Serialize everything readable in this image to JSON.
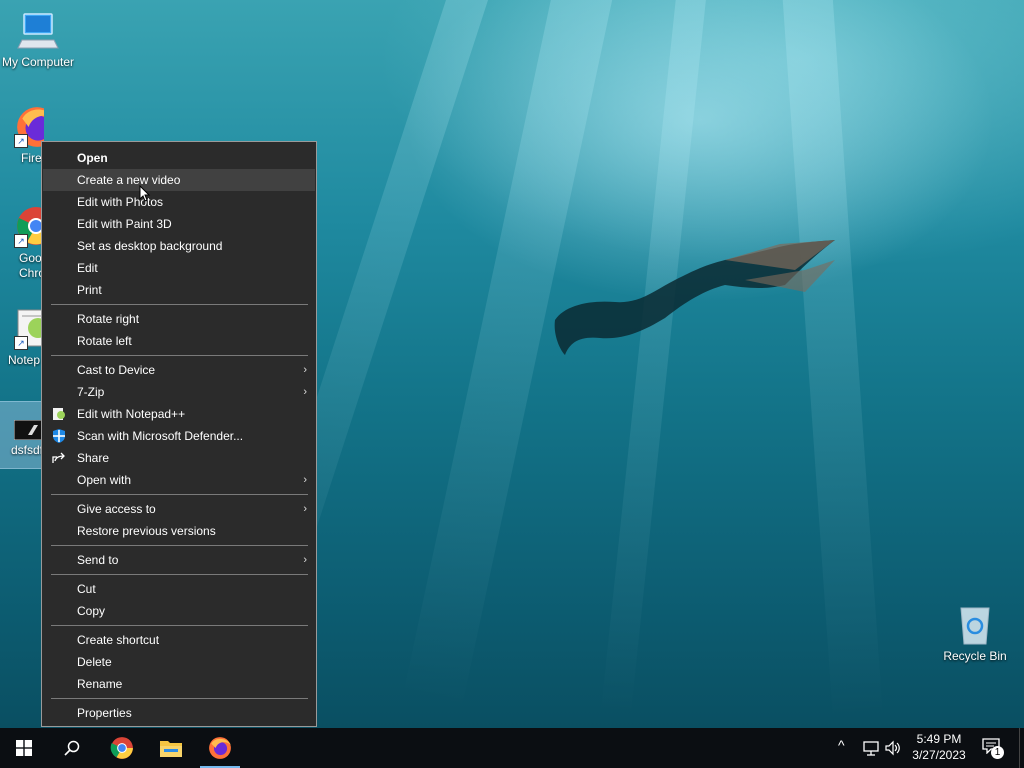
{
  "desktop": {
    "icons": [
      {
        "label": "My Computer",
        "icon": "computer-icon"
      },
      {
        "label": "Fire",
        "icon": "firefox-icon"
      },
      {
        "label": "Goo",
        "label2": "Chro",
        "icon": "chrome-icon"
      },
      {
        "label": "Notep",
        "icon": "notepadpp-icon"
      },
      {
        "label": "dsfsdf",
        "icon": "image-file-icon"
      },
      {
        "label": "Recycle Bin",
        "icon": "recycle-bin-icon"
      }
    ]
  },
  "context_menu": {
    "items": [
      {
        "label": "Open",
        "bold": true
      },
      {
        "label": "Create a new video",
        "hover": true
      },
      {
        "label": "Edit with Photos"
      },
      {
        "label": "Edit with Paint 3D"
      },
      {
        "label": "Set as desktop background"
      },
      {
        "label": "Edit"
      },
      {
        "label": "Print"
      },
      {
        "label": "Rotate right"
      },
      {
        "label": "Rotate left"
      },
      {
        "label": "Cast to Device",
        "submenu": true
      },
      {
        "label": "7-Zip",
        "submenu": true
      },
      {
        "label": "Edit with Notepad++",
        "icon": "notepadpp-icon"
      },
      {
        "label": "Scan with Microsoft Defender...",
        "icon": "defender-shield-icon"
      },
      {
        "label": "Share",
        "icon": "share-icon"
      },
      {
        "label": "Open with",
        "submenu": true
      },
      {
        "label": "Give access to",
        "submenu": true
      },
      {
        "label": "Restore previous versions"
      },
      {
        "label": "Send to",
        "submenu": true
      },
      {
        "label": "Cut"
      },
      {
        "label": "Copy"
      },
      {
        "label": "Create shortcut"
      },
      {
        "label": "Delete"
      },
      {
        "label": "Rename"
      },
      {
        "label": "Properties"
      }
    ],
    "submenu_arrow": "›"
  },
  "taskbar": {
    "start_icon": "windows-logo-icon",
    "search_icon": "search-icon",
    "pinned": [
      {
        "name": "chrome",
        "icon": "chrome-icon"
      },
      {
        "name": "file-explorer",
        "icon": "folder-icon"
      },
      {
        "name": "firefox",
        "icon": "firefox-icon",
        "active": true
      }
    ],
    "tray": {
      "chevron": "^",
      "time": "5:49 PM",
      "date": "3/27/2023",
      "notification_count": "1"
    }
  },
  "colors": {
    "menu_bg": "#2b2b2b",
    "menu_hover": "#414141",
    "taskbar_bg": "#0b0e12",
    "accent": "#76b9ed"
  }
}
